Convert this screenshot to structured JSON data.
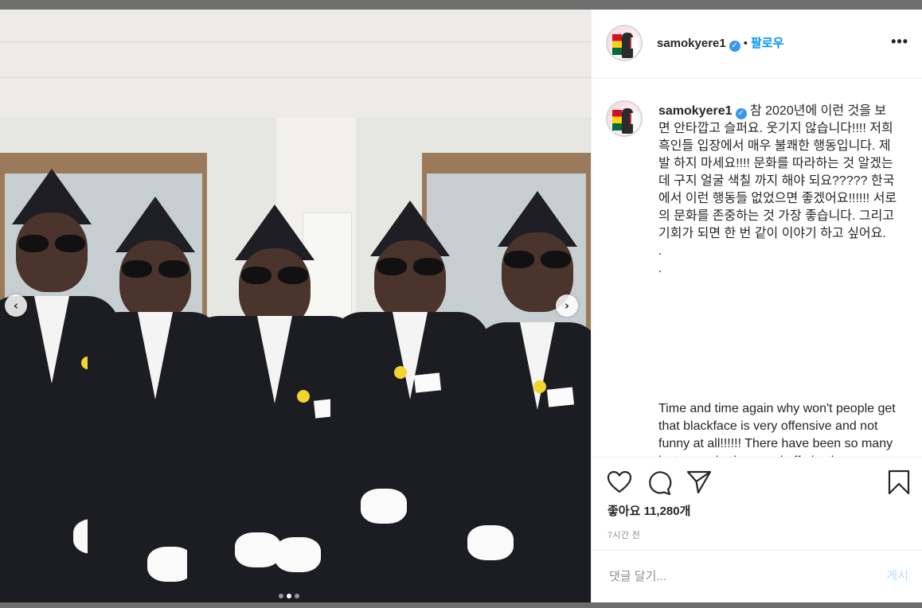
{
  "post": {
    "username": "samokyere1",
    "follow_separator": "•",
    "follow_label": "팔로우",
    "more_label": "•••",
    "caption_ko": "참 2020년에 이런 것을 보면 안타깝고 슬퍼요. 웃기지 않습니다!!!! 저희 흑인들 입장에서 매우 불쾌한 행동입니다. 제발 하지 마세요!!!! 문화를 따라하는 것 알겠는데 구지 얼굴 색칠 까지 해야 되요????? 한국에서 이런 행동들 없었으면 좋겠어요!!!!!! 서로의 문화를 존중하는 것 가장 좋습니다. 그리고 기회가 되면 한 번 같이 이야기 하고 싶어요.\n.\n.",
    "caption_en": "Time and time again why won't people get that blackface is very offensive and not funny at all!!!!!! There have been so many instances both on and off air where people paint their faces black here in Korea and think it's funny! It's not and I am",
    "likes_label": "좋아요 11,280개",
    "time_label": "7시간 전",
    "comment_placeholder": "댓글 달기...",
    "post_label": "게시"
  },
  "media": {
    "prev_label": "‹",
    "next_label": "›",
    "carousel_dots": 3,
    "active_dot": 2
  },
  "icons": {
    "like": "heart-icon",
    "comment": "comment-icon",
    "share": "paper-plane-icon",
    "save": "bookmark-icon",
    "verified": "verified-badge-icon"
  },
  "colors": {
    "follow": "#0095f6",
    "verified": "#3897f0",
    "post_disabled": "#b2dffc",
    "meta": "#8e8e8e"
  }
}
